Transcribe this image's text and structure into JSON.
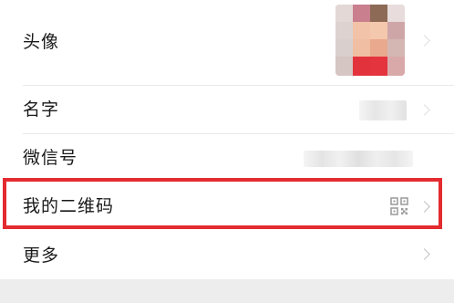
{
  "profile_list": {
    "avatar_label": "头像",
    "name_label": "名字",
    "wechat_id_label": "微信号",
    "qr_code_label": "我的二维码",
    "more_label": "更多"
  },
  "icons": {
    "qr": "qr-code-icon",
    "chevron": "chevron-right-icon"
  },
  "colors": {
    "highlight": "#e32b30",
    "chevron": "#c2c2c2",
    "background": "#ffffff",
    "footer": "#ededed"
  }
}
